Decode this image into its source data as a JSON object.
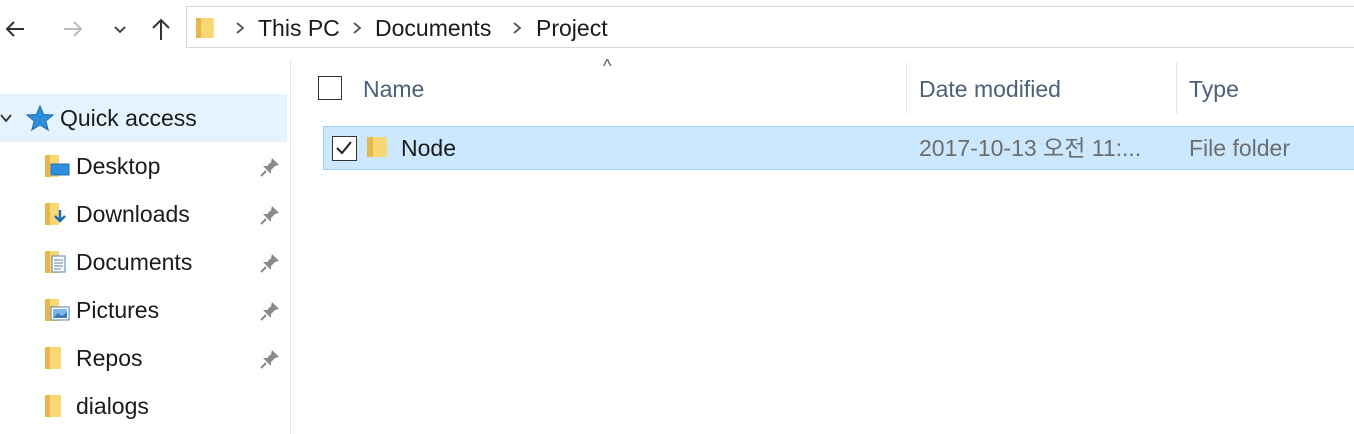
{
  "nav": {
    "back_icon": "back-arrow-icon",
    "forward_icon": "forward-arrow-icon",
    "recent_icon": "chevron-down-icon",
    "up_icon": "up-arrow-icon"
  },
  "address_bar": {
    "breadcrumbs": [
      "This PC",
      "Documents",
      "Project"
    ]
  },
  "sidebar": {
    "quick_access_label": "Quick access",
    "items": [
      {
        "label": "Desktop",
        "icon": "desktop-folder-icon",
        "pinned": true
      },
      {
        "label": "Downloads",
        "icon": "downloads-folder-icon",
        "pinned": true
      },
      {
        "label": "Documents",
        "icon": "documents-folder-icon",
        "pinned": true
      },
      {
        "label": "Pictures",
        "icon": "pictures-folder-icon",
        "pinned": true
      },
      {
        "label": "Repos",
        "icon": "folder-icon",
        "pinned": true
      },
      {
        "label": "dialogs",
        "icon": "folder-icon",
        "pinned": false
      }
    ]
  },
  "file_list": {
    "columns": [
      "Name",
      "Date modified",
      "Type"
    ],
    "sort_indicator": "^",
    "rows": [
      {
        "name": "Node",
        "date_modified": "2017-10-13 오전 11:...",
        "type": "File folder",
        "selected": true,
        "checked": true
      }
    ]
  },
  "colors": {
    "selection_bg": "#cce8ff",
    "selection_border": "#99d1ff",
    "hover_bg": "#e5f3ff",
    "header_text": "#4c607a",
    "folder_yellow": "#f8d775"
  }
}
